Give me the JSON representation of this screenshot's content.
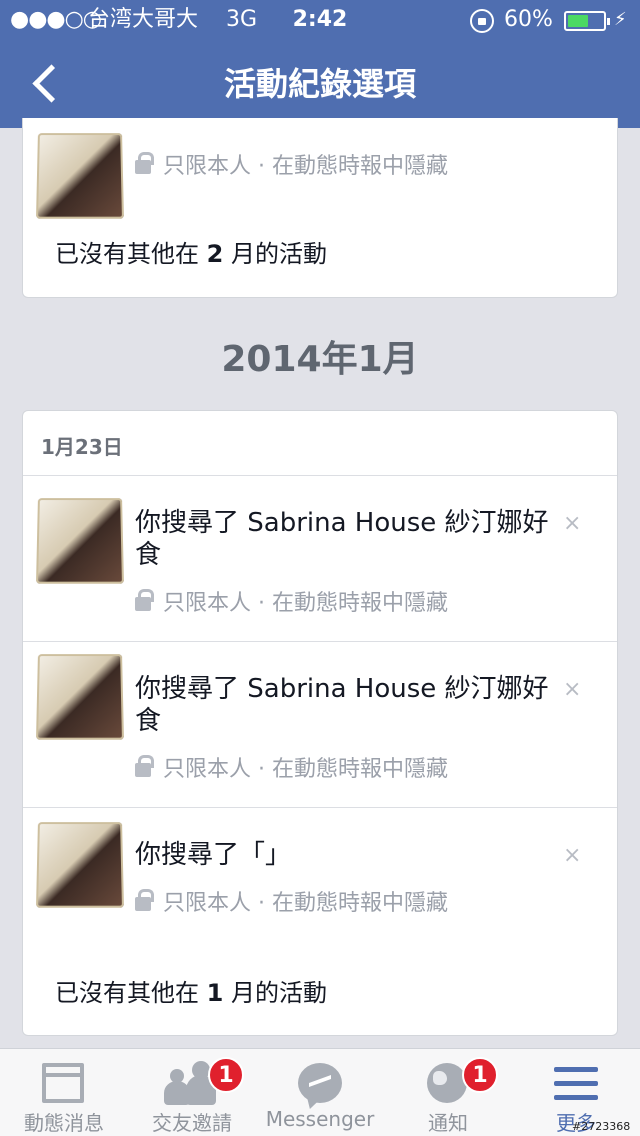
{
  "status_bar": {
    "signal": "●●●○○",
    "carrier": "台湾大哥大",
    "network": "3G",
    "time": "2:42",
    "battery": "60%",
    "battery_level": 0.6,
    "bolt": "⚡"
  },
  "nav": {
    "title": "活動紀錄選項"
  },
  "card1": {
    "privacy": "只限本人 · 在動態時報中隱藏",
    "no_more_prefix": "已沒有其他在",
    "no_more_num": "2",
    "no_more_suffix": "月的活動"
  },
  "month_heading": "2014年1月",
  "card2": {
    "date": "1月23日",
    "entries": [
      {
        "text": "你搜尋了 Sabrina House 紗汀娜好食",
        "privacy": "只限本人 · 在動態時報中隱藏",
        "close": "×"
      },
      {
        "text": "你搜尋了 Sabrina House 紗汀娜好食",
        "privacy": "只限本人 · 在動態時報中隱藏",
        "close": "×"
      },
      {
        "text": "你搜尋了「」",
        "privacy": "只限本人 · 在動態時報中隱藏",
        "close": "×"
      }
    ],
    "no_more_prefix": "已沒有其他在",
    "no_more_num": "1",
    "no_more_suffix": "月的活動"
  },
  "tabbar": {
    "tabs": [
      {
        "label": "動態消息",
        "icon": "news-feed-icon"
      },
      {
        "label": "交友邀請",
        "icon": "friends-icon",
        "badge": "1"
      },
      {
        "label": "Messenger",
        "icon": "messenger-icon"
      },
      {
        "label": "通知",
        "icon": "globe-icon",
        "badge": "1"
      },
      {
        "label": "更多",
        "icon": "menu-icon",
        "active": true
      }
    ]
  },
  "watermark": "#2723368",
  "colors": {
    "nav_blue": "#4f6eb0",
    "badge_red": "#e0202d",
    "battery_green": "#4cd964"
  }
}
